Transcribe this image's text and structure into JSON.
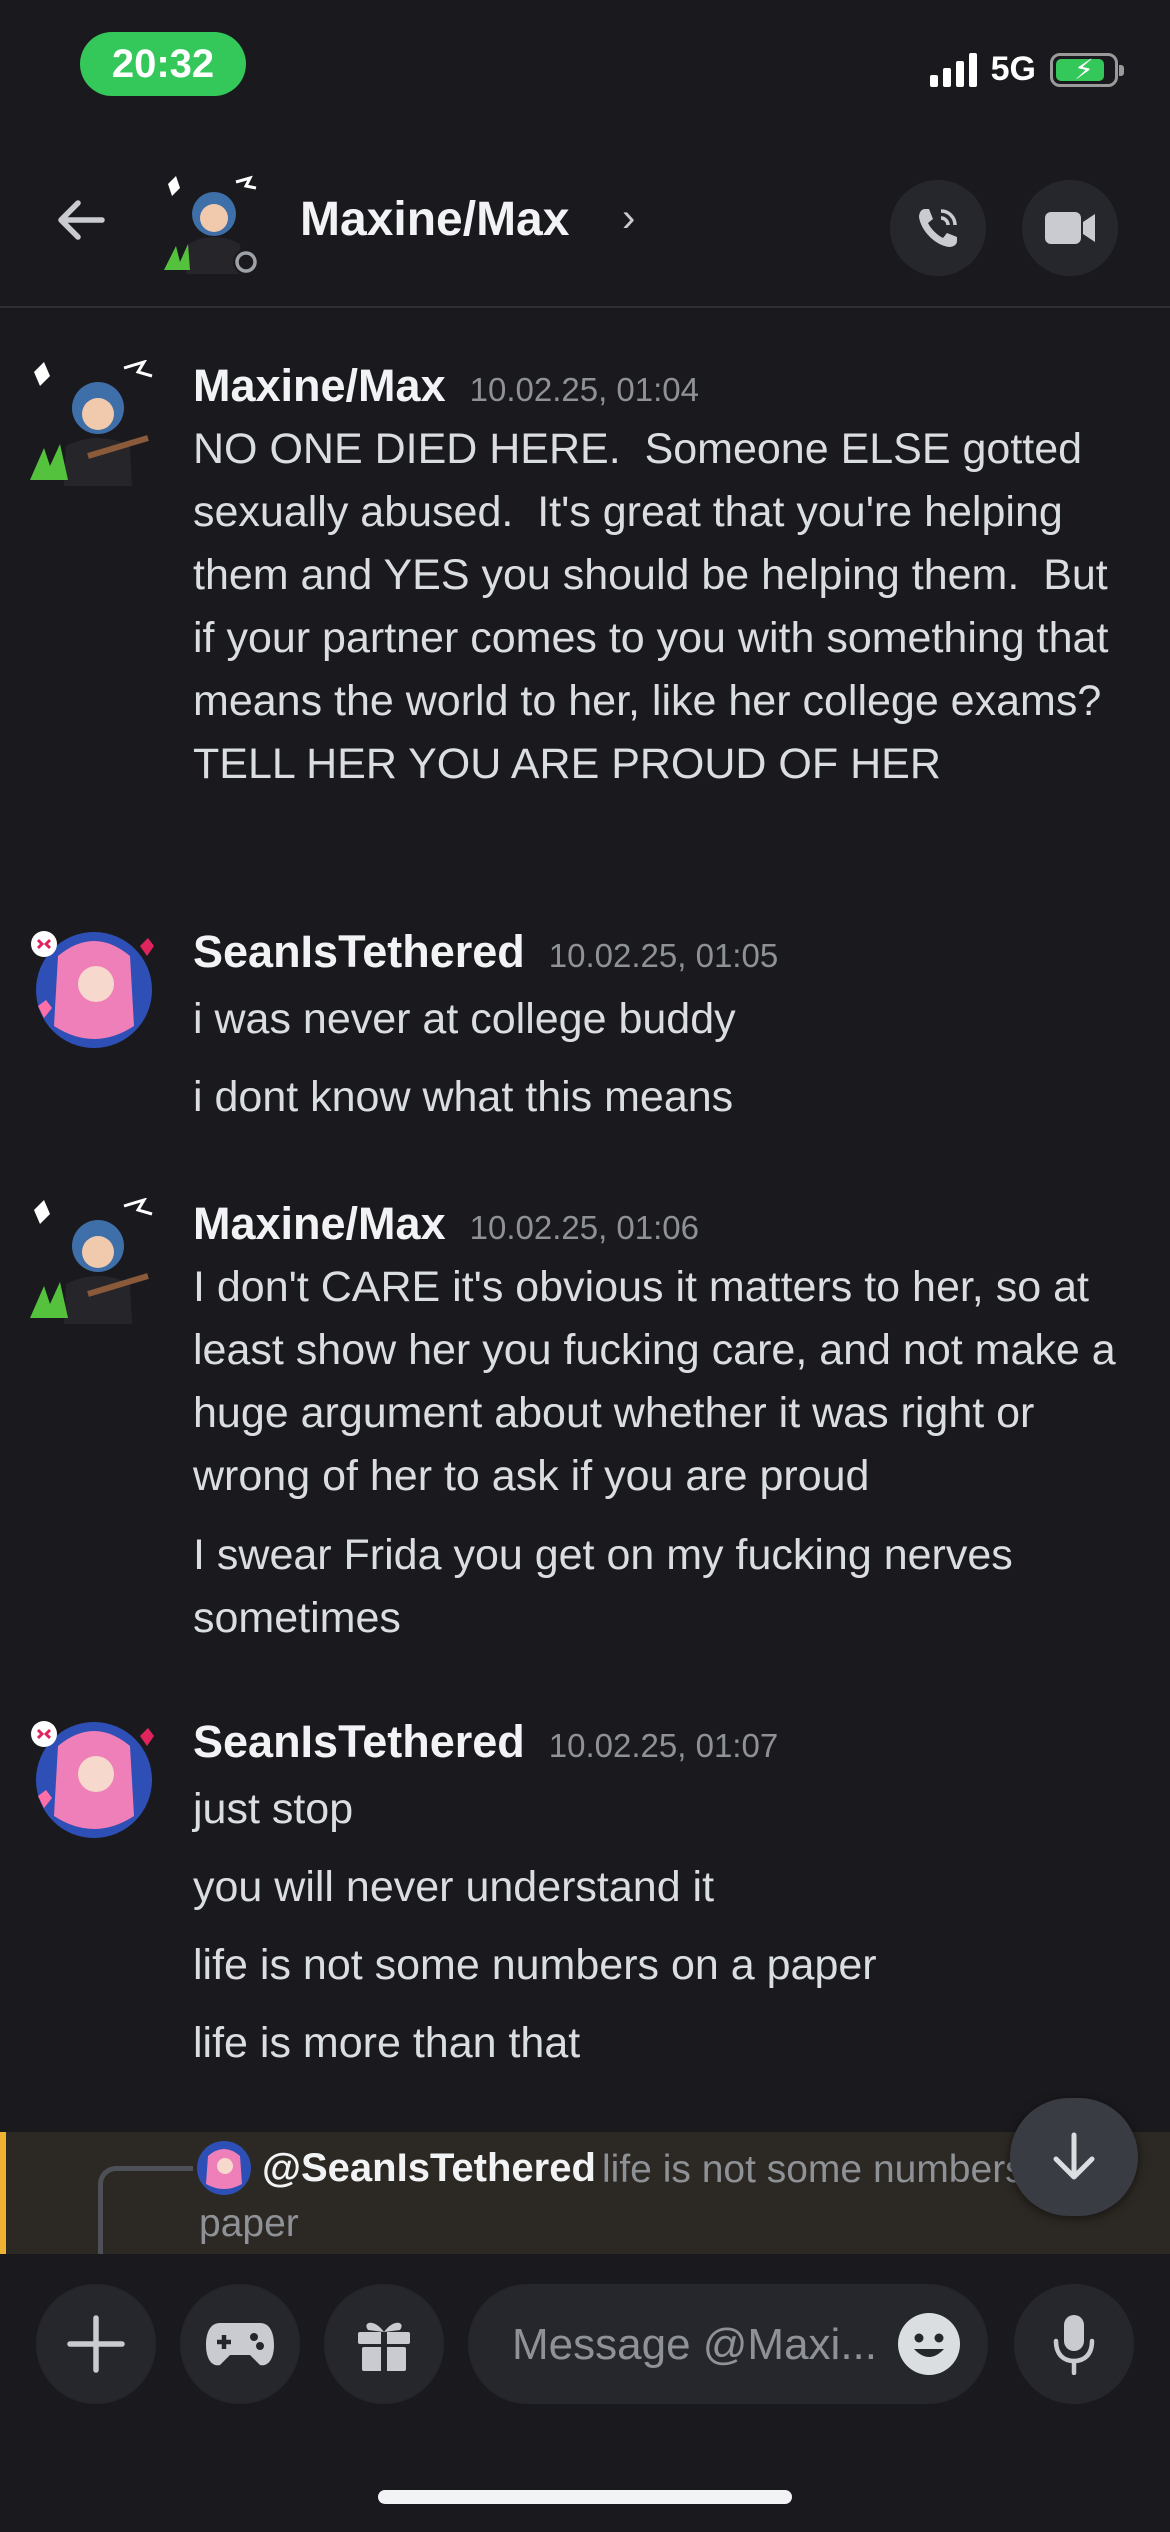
{
  "status": {
    "time": "20:32",
    "network": "5G"
  },
  "header": {
    "title": "Maxine/Max"
  },
  "messages": [
    {
      "author": "Maxine/Max",
      "timestamp": "10.02.25, 01:04",
      "lines": [
        "NO ONE DIED HERE.  Someone ELSE gotted sexually abused.  It's great that you're helping them and YES you should be helping them.  But if your partner comes to you with something that means the world to her, like her college exams?  TELL HER YOU ARE PROUD OF HER"
      ]
    },
    {
      "author": "SeanIsTethered",
      "timestamp": "10.02.25, 01:05",
      "lines": [
        "i was never at college buddy",
        "i dont know what this means"
      ]
    },
    {
      "author": "Maxine/Max",
      "timestamp": "10.02.25, 01:06",
      "lines": [
        "I don't CARE it's obvious it matters to her, so at least show her you fucking care, and not make a huge argument about whether it was right or wrong of her to ask if you are proud",
        "I swear Frida you get on my fucking nerves sometimes"
      ]
    },
    {
      "author": "SeanIsTethered",
      "timestamp": "10.02.25, 01:07",
      "lines": [
        "just stop",
        "you will never understand it",
        "life is not some numbers on a paper",
        "life is more than that"
      ]
    }
  ],
  "reply": {
    "user": "@SeanIsTethered",
    "text_line1": "life is not some numbers",
    "text_line2": "paper"
  },
  "composer": {
    "placeholder": "Message @Maxi..."
  }
}
